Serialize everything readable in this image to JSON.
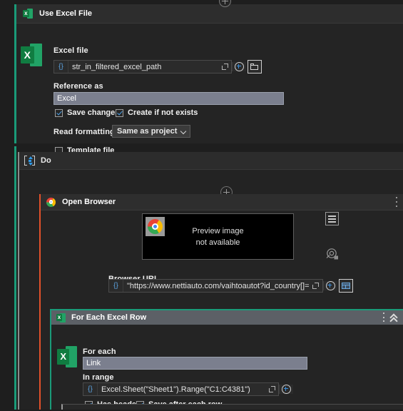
{
  "top_add_button": {
    "icon": "plus-circle-icon"
  },
  "excel_activity": {
    "title": "Use Excel File",
    "icon": "excel-file-icon",
    "excel_file": {
      "label": "Excel file",
      "value": "str_in_filtered_excel_path",
      "expression_marker": "{}",
      "expand_icon": "expand-icon",
      "plus_icon": "plus-circle-icon",
      "browse_icon": "folder-icon"
    },
    "reference_as": {
      "label": "Reference as",
      "value": "Excel"
    },
    "checkboxes": [
      {
        "label": "Save changes",
        "checked": true
      },
      {
        "label": "Create if not exists",
        "checked": true
      },
      {
        "label": "Template file",
        "checked": false
      }
    ],
    "read_formatting": {
      "label": "Read formatting",
      "value": "Same as project",
      "caret_icon": "chevron-down-icon"
    }
  },
  "do_container": {
    "title": "Do",
    "icon": "sequence-icon",
    "add_button_icon": "plus-circle-icon"
  },
  "open_browser_activity": {
    "title": "Open Browser",
    "icon": "chrome-icon",
    "menu_icon": "kebab-menu-icon",
    "preview": {
      "line1": "Preview image",
      "line2": "not available",
      "thumb_icon": "chrome-icon"
    },
    "side_buttons": {
      "hamburger_icon": "hamburger-menu-icon",
      "target_icon": "target-crosshair-icon"
    },
    "browser_url": {
      "label": "Browser URL",
      "value": "\"https://www.nettiauto.com/vaihtoautot?id_country[]=",
      "expression_marker": "{}",
      "expand_icon": "expand-icon",
      "plus_icon": "plus-circle-icon",
      "indicate_icon": "indicate-window-icon"
    }
  },
  "for_each_activity": {
    "title": "For Each Excel Row",
    "icon": "excel-file-icon",
    "menu_icon": "kebab-menu-icon",
    "collapse_icon": "double-chevron-up-icon",
    "for_each": {
      "label": "For each",
      "value": "Link"
    },
    "in_range": {
      "label": "In range",
      "value": "Excel.Sheet(\"Sheet1\").Range(\"C1:C4381\")",
      "expression_marker": "{}",
      "expand_icon": "expand-icon",
      "plus_icon": "plus-circle-icon"
    },
    "checkboxes": [
      {
        "label": "Has headers",
        "checked": true
      },
      {
        "label": "Save after each row",
        "checked": true
      }
    ]
  },
  "colors": {
    "excel_green": "#1a9b79",
    "browser_orange": "#e2512a",
    "accent_blue": "#3b8fdd",
    "selection_gray": "#7b7f8e"
  }
}
